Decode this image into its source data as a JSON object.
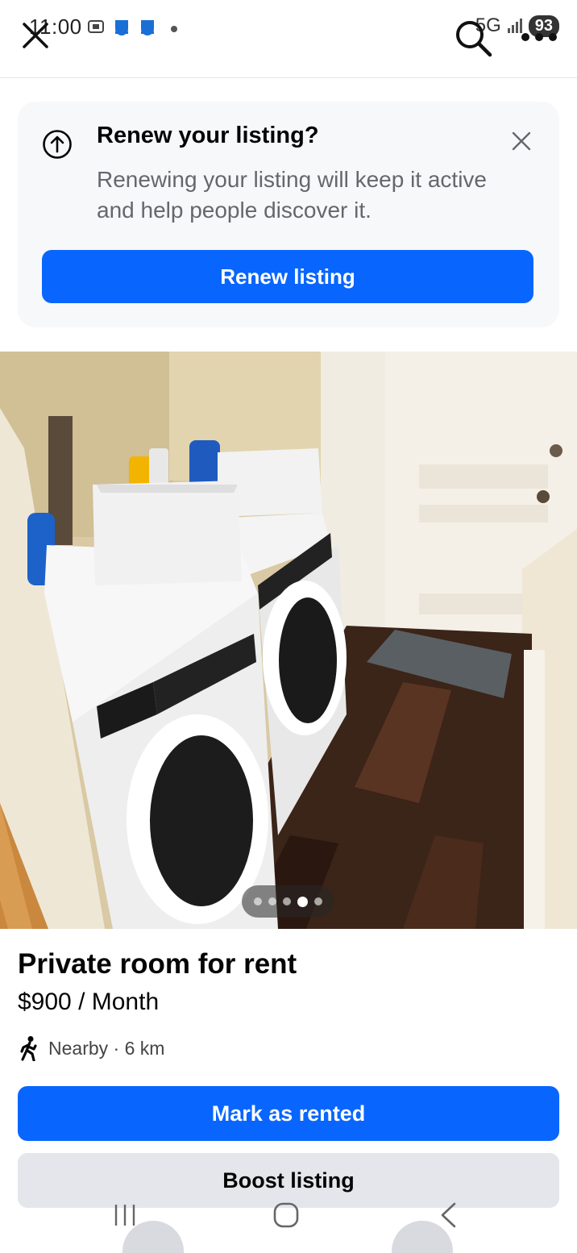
{
  "status_bar": {
    "time": "11:00",
    "network": "5G",
    "battery": "93",
    "icons": [
      "screenshot-icon",
      "notification-icon",
      "notification-icon",
      "dot-icon"
    ]
  },
  "nav": {
    "close_icon": "close-icon",
    "search_icon": "search-icon",
    "more_icon": "more-icon"
  },
  "renew_card": {
    "icon": "upload-circle-icon",
    "title": "Renew your listing?",
    "description": "Renewing your listing will keep it active and help people discover it.",
    "button_label": "Renew listing",
    "close_icon": "close-icon"
  },
  "photo": {
    "carousel_count": 5,
    "carousel_active_index": 3
  },
  "listing": {
    "title": "Private room for rent",
    "price": "$900 / Month",
    "distance": "Nearby · 6 km",
    "distance_icon": "walking-person-icon"
  },
  "actions": {
    "mark_rented_label": "Mark as rented",
    "boost_label": "Boost listing"
  },
  "colors": {
    "accent": "#0866ff",
    "secondary_button": "#e4e6eb",
    "card_background": "#f7f8fa"
  }
}
